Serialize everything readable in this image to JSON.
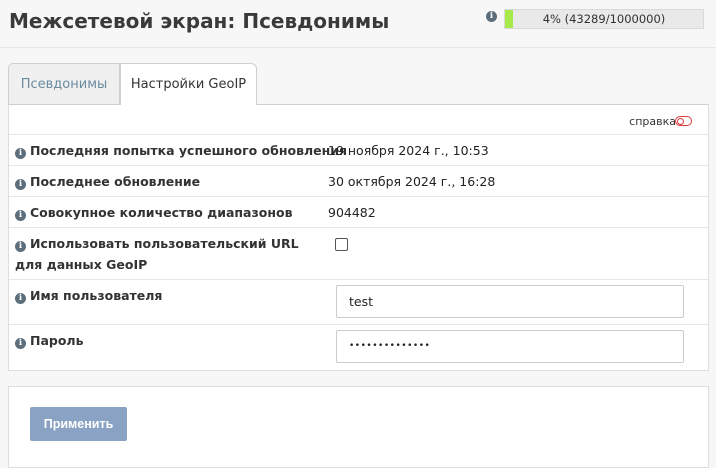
{
  "header": {
    "title": "Межсетевой экран: Псевдонимы",
    "usage": {
      "percent": 4,
      "text": "4% (43289/1000000)"
    }
  },
  "tabs": [
    {
      "label": "Псевдонимы",
      "active": false
    },
    {
      "label": "Настройки GeoIP",
      "active": true
    }
  ],
  "help": {
    "label": "справка"
  },
  "rows": {
    "last_success": {
      "label": "Последняя попытка успешного обновления",
      "value": "19 ноября 2024 г., 10:53"
    },
    "last_update": {
      "label": "Последнее обновление",
      "value": "30 октября 2024 г., 16:28"
    },
    "total_ranges": {
      "label": "Совокупное количество диапазонов",
      "value": "904482"
    },
    "custom_url": {
      "label": "Использовать пользовательский URL для данных GeoIP",
      "checked": false
    },
    "username": {
      "label": "Имя пользователя",
      "value": "test"
    },
    "password": {
      "label": "Пароль",
      "value": "••••••••••••••"
    }
  },
  "footer": {
    "apply_label": "Применить"
  },
  "colors": {
    "usage_fill": "#a7e84a",
    "apply_button": "#8aa2c4",
    "toggle": "#e0393e"
  }
}
